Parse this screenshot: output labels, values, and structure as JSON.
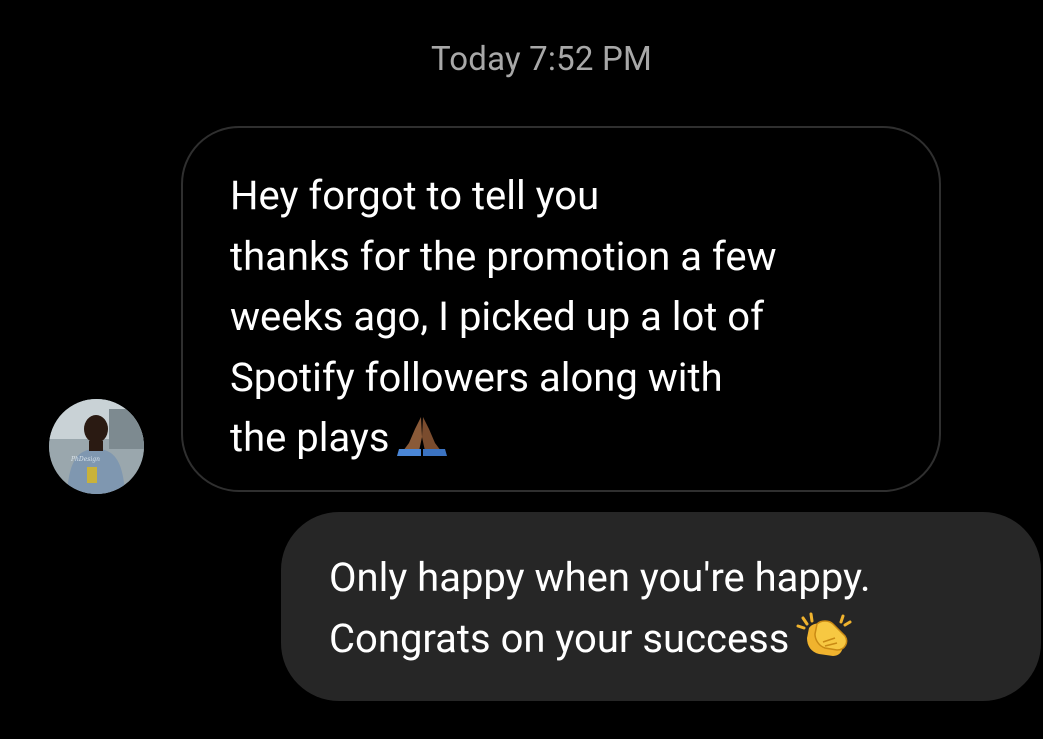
{
  "thread": {
    "timestamp": "Today 7:52 PM"
  },
  "received_message": {
    "lines": [
      "Hey  forgot to tell you",
      "thanks for the promotion a few",
      "weeks ago, I picked up a lot of",
      "Spotify followers along with",
      "the plays"
    ],
    "emoji": "folded-hands-emoji"
  },
  "sent_message": {
    "lines": [
      "Only happy when you're happy.",
      "Congrats on your success"
    ],
    "emoji": "clapping-hands-emoji"
  },
  "avatar": {
    "icon": "contact-avatar-photo"
  },
  "colors": {
    "background": "#000000",
    "timestamp": "#a8a8a8",
    "received_bubble_border": "#2f2f2f",
    "sent_bubble": "#262626",
    "text": "#ffffff"
  }
}
